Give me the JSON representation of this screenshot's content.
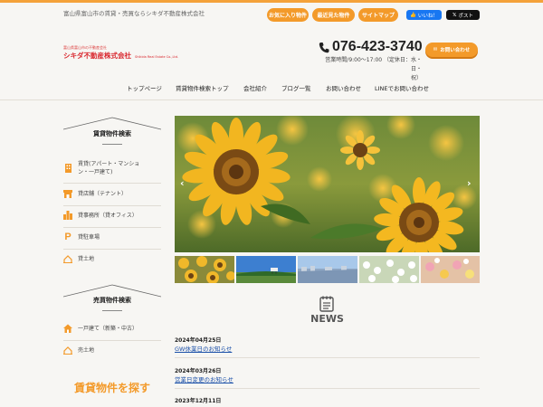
{
  "header": {
    "tagline": "富山県富山市の賃貸・売買ならシキダ不動産株式会社",
    "buttons": [
      "お気に入り物件",
      "最近見た物件",
      "サイトマップ"
    ],
    "facebook_label": "いいね！",
    "x_label": "ポスト",
    "logo_small": "富山県富山市の不動産会社",
    "logo_name": "シキダ不動産株式会社",
    "logo_en": "Shikida Real Estate Co.,Ltd.",
    "phone": "076-423-3740",
    "hours_line1": "営業時間/9:00～17:00 （定休日：水・日・",
    "hours_line2": "祝）",
    "contact_label": "お問い合わせ"
  },
  "nav": [
    "トップページ",
    "賃貸物件検索トップ",
    "会社紹介",
    "ブログ一覧",
    "お問い合わせ",
    "LINEでお問い合わせ"
  ],
  "sidebar": {
    "rent_title": "賃貸物件検索",
    "rent_items": [
      {
        "label": "賃貸(アパート・マンション・一戸建て)",
        "icon": "building-icon"
      },
      {
        "label": "貸店舗（テナント）",
        "icon": "shop-icon"
      },
      {
        "label": "貸事務所（貸オフィス）",
        "icon": "office-icon"
      },
      {
        "label": "貸駐車場",
        "icon": "parking-icon"
      },
      {
        "label": "貸土地",
        "icon": "land-icon"
      }
    ],
    "sale_title": "売買物件検索",
    "sale_items": [
      {
        "label": "一戸建て（新築・中古）",
        "icon": "house-icon"
      },
      {
        "label": "売土地",
        "icon": "land-icon"
      }
    ],
    "search_title": "賃貸物件を探す"
  },
  "news": {
    "title": "NEWS",
    "items": [
      {
        "date": "2024年04月25日",
        "text": "GW休業日のお知らせ"
      },
      {
        "date": "2024年03月26日",
        "text": "営業日変更のお知らせ"
      },
      {
        "date": "2023年12月11日",
        "text": ""
      }
    ]
  },
  "colors": {
    "accent": "#f39a2a",
    "brand": "#d9282f"
  }
}
